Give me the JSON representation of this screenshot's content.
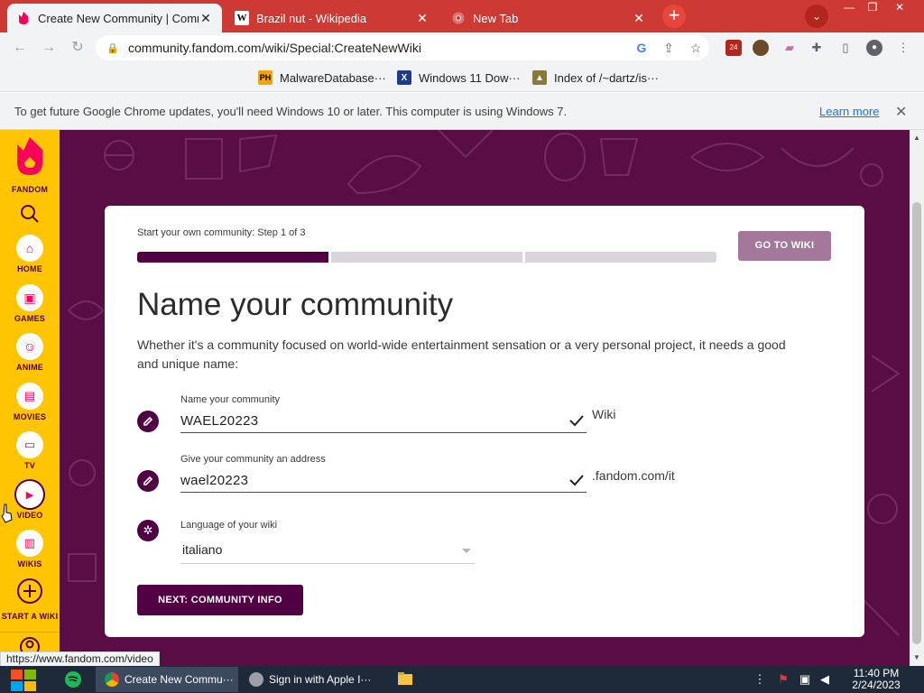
{
  "browser": {
    "tabs": [
      {
        "title": "Create New Community | Comm",
        "active": true
      },
      {
        "title": "Brazil nut - Wikipedia",
        "active": false
      },
      {
        "title": "New Tab",
        "active": false
      }
    ],
    "url": "community.fandom.com/wiki/Special:CreateNewWiki",
    "extension_badge": "24",
    "bookmarks": [
      {
        "label": "MalwareDatabase···",
        "icon": "PH"
      },
      {
        "label": "Windows 11 Dow···",
        "icon": "X"
      },
      {
        "label": "Index of /~dartz/is···",
        "icon": "folder"
      }
    ],
    "infobar": {
      "message": "To get future Google Chrome updates, you'll need Windows 10 or later. This computer is using Windows 7.",
      "link": "Learn more"
    },
    "status_url": "https://www.fandom.com/video"
  },
  "rail": {
    "brand": "FANDOM",
    "items": [
      {
        "label": "HOME"
      },
      {
        "label": "GAMES"
      },
      {
        "label": "ANIME"
      },
      {
        "label": "MOVIES"
      },
      {
        "label": "TV"
      },
      {
        "label": "VIDEO"
      },
      {
        "label": "WIKIS"
      },
      {
        "label": "START A WIKI"
      }
    ]
  },
  "form": {
    "step_text": "Start your own community: Step 1 of 3",
    "progress_step": 1,
    "progress_total": 3,
    "go_to_wiki": "GO TO WIKI",
    "heading": "Name your community",
    "description": "Whether it's a community focused on world-wide entertainment sensation or a very personal project, it needs a good and unique name:",
    "name_label": "Name your community",
    "name_value": "WAEL20223",
    "name_suffix": "Wiki",
    "address_label": "Give your community an address",
    "address_value": "wael20223",
    "address_suffix": ".fandom.com/it",
    "language_label": "Language of your wiki",
    "language_value": "italiano",
    "next_button": "NEXT: COMMUNITY INFO"
  },
  "taskbar": {
    "tasks": [
      {
        "label": "Create New Commu···",
        "active": true
      },
      {
        "label": "Sign in with Apple I···",
        "active": false
      }
    ],
    "time": "11:40 PM",
    "date": "2/24/2023"
  },
  "colors": {
    "fandom_purple": "#520044",
    "fandom_yellow": "#ffc500",
    "chrome_red": "#cc3a33"
  }
}
